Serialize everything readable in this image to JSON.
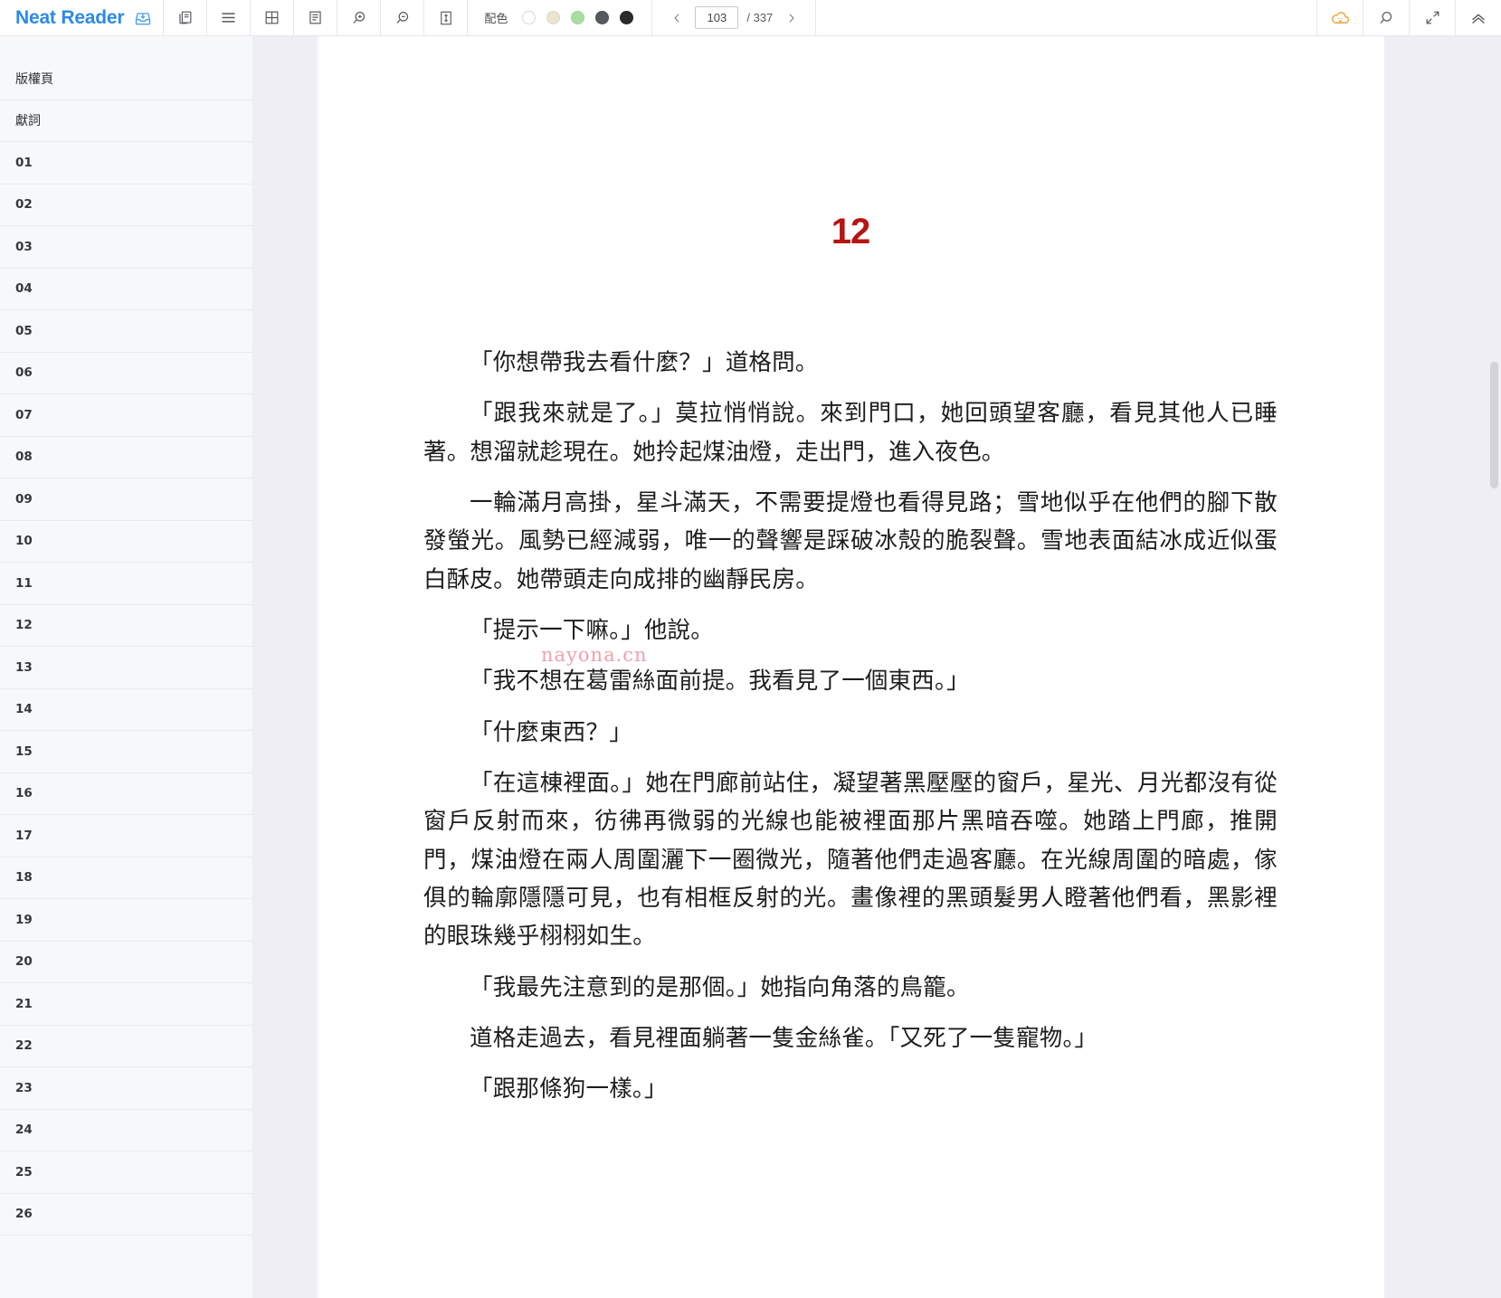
{
  "app": {
    "brand_name": "Neat Reader",
    "brand_icon": "save-to-library-icon"
  },
  "toolbar": {
    "buttons": [
      {
        "name": "copy-book-icon",
        "label": ""
      },
      {
        "name": "menu-icon",
        "label": ""
      },
      {
        "name": "grid-layout-icon",
        "label": ""
      },
      {
        "name": "page-layout-icon",
        "label": ""
      },
      {
        "name": "zoom-in-icon",
        "label": ""
      },
      {
        "name": "zoom-out-icon",
        "label": ""
      },
      {
        "name": "fit-height-icon",
        "label": ""
      }
    ],
    "theme": {
      "label": "配色",
      "swatches": [
        {
          "name": "theme-white",
          "color": "#ffffff",
          "border": "#d6d6dc"
        },
        {
          "name": "theme-sepia",
          "color": "#ebe4cf",
          "border": "#ddd6bf"
        },
        {
          "name": "theme-green",
          "color": "#a8dfa0",
          "border": "#9bd393"
        },
        {
          "name": "theme-gray",
          "color": "#565a5e",
          "border": "#4b4f53"
        },
        {
          "name": "theme-black",
          "color": "#2b2b2d",
          "border": "#232325"
        }
      ]
    },
    "pager": {
      "prev_label": "‹",
      "next_label": "›",
      "current_page": "103",
      "total_label": "/ 337"
    },
    "right_buttons": [
      {
        "name": "cloud-sync-icon",
        "color": "#efa13c"
      },
      {
        "name": "search-icon",
        "color": "#58585e"
      },
      {
        "name": "fullscreen-icon",
        "color": "#58585e"
      },
      {
        "name": "collapse-up-icon",
        "color": "#58585e"
      }
    ]
  },
  "toc": {
    "items": [
      {
        "label": "版權頁",
        "active": false,
        "numeric": false
      },
      {
        "label": "獻詞",
        "active": false,
        "numeric": false
      },
      {
        "label": "01",
        "active": false,
        "numeric": true
      },
      {
        "label": "02",
        "active": false,
        "numeric": true
      },
      {
        "label": "03",
        "active": false,
        "numeric": true
      },
      {
        "label": "04",
        "active": false,
        "numeric": true
      },
      {
        "label": "05",
        "active": false,
        "numeric": true
      },
      {
        "label": "06",
        "active": false,
        "numeric": true
      },
      {
        "label": "07",
        "active": false,
        "numeric": true
      },
      {
        "label": "08",
        "active": false,
        "numeric": true
      },
      {
        "label": "09",
        "active": false,
        "numeric": true
      },
      {
        "label": "10",
        "active": false,
        "numeric": true
      },
      {
        "label": "11",
        "active": false,
        "numeric": true
      },
      {
        "label": "12",
        "active": true,
        "numeric": true
      },
      {
        "label": "13",
        "active": false,
        "numeric": true
      },
      {
        "label": "14",
        "active": false,
        "numeric": true
      },
      {
        "label": "15",
        "active": false,
        "numeric": true
      },
      {
        "label": "16",
        "active": false,
        "numeric": true
      },
      {
        "label": "17",
        "active": false,
        "numeric": true
      },
      {
        "label": "18",
        "active": false,
        "numeric": true
      },
      {
        "label": "19",
        "active": false,
        "numeric": true
      },
      {
        "label": "20",
        "active": false,
        "numeric": true
      },
      {
        "label": "21",
        "active": false,
        "numeric": true
      },
      {
        "label": "22",
        "active": false,
        "numeric": true
      },
      {
        "label": "23",
        "active": false,
        "numeric": true
      },
      {
        "label": "24",
        "active": false,
        "numeric": true
      },
      {
        "label": "25",
        "active": false,
        "numeric": true
      },
      {
        "label": "26",
        "active": false,
        "numeric": true
      }
    ]
  },
  "content": {
    "chapter_number": "12",
    "watermark": "nayona.cn",
    "paragraphs": [
      "「你想帶我去看什麼？」道格問。",
      "「跟我來就是了。」莫拉悄悄說。來到門口，她回頭望客廳，看見其他人已睡著。想溜就趁現在。她拎起煤油燈，走出門，進入夜色。",
      "一輪滿月高掛，星斗滿天，不需要提燈也看得見路；雪地似乎在他們的腳下散發螢光。風勢已經減弱，唯一的聲響是踩破冰殼的脆裂聲。雪地表面結冰成近似蛋白酥皮。她帶頭走向成排的幽靜民房。",
      "「提示一下嘛。」他說。",
      "「我不想在葛雷絲面前提。我看見了一個東西。」",
      "「什麼東西？」",
      "「在這棟裡面。」她在門廊前站住，凝望著黑壓壓的窗戶，星光、月光都沒有從窗戶反射而來，彷彿再微弱的光線也能被裡面那片黑暗吞噬。她踏上門廊，推開門，煤油燈在兩人周圍灑下一圈微光，隨著他們走過客廳。在光線周圍的暗處，傢俱的輪廓隱隱可見，也有相框反射的光。畫像裡的黑頭髮男人瞪著他們看，黑影裡的眼珠幾乎栩栩如生。",
      "「我最先注意到的是那個。」她指向角落的鳥籠。",
      "道格走過去，看見裡面躺著一隻金絲雀。「又死了一隻寵物。」",
      "「跟那條狗一樣。」"
    ]
  }
}
